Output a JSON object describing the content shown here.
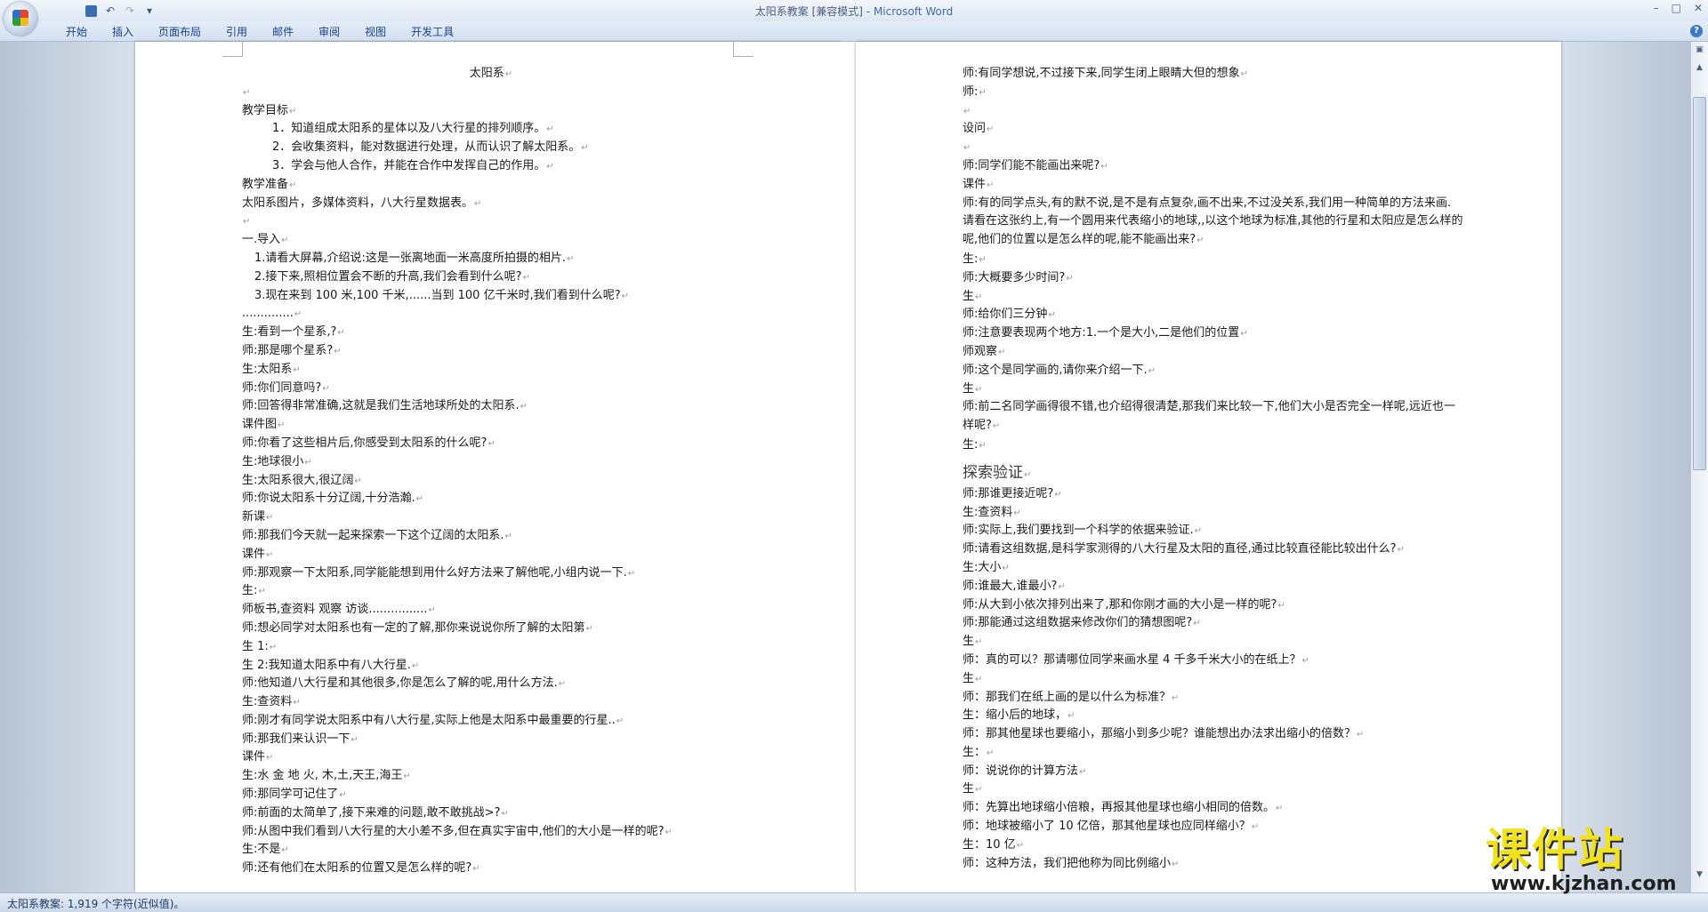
{
  "window": {
    "title_doc": "太阳系教案 [兼容模式]",
    "title_sep": " - ",
    "title_app": "Microsoft Word",
    "controls": {
      "minimize": "–",
      "maximize": "□",
      "close": "✕"
    }
  },
  "quick_access": {
    "undo": "↶",
    "redo": "↷",
    "more": "▾"
  },
  "ribbon_tabs": [
    "开始",
    "插入",
    "页面布局",
    "引用",
    "邮件",
    "审阅",
    "视图",
    "开发工具"
  ],
  "help": "?",
  "page1_lines": [
    "太阳系",
    "",
    "教学目标",
    "1．知道组成太阳系的星体以及八大行星的排列顺序。",
    "2．会收集资料，能对数据进行处理，从而认识了解太阳系。",
    "3．学会与他人合作，并能在合作中发挥自己的作用。",
    "教学准备",
    "太阳系图片，多媒体资料，八大行星数据表。",
    "",
    "一.导入",
    "1.请看大屏幕,介绍说:这是一张离地面一米高度所拍摄的相片.",
    "2.接下来,照相位置会不断的升高,我们会看到什么呢?",
    "3.现在来到 100 米,100 千米,......当到 100 亿千米时,我们看到什么呢?",
    "..............",
    "生:看到一个星系,?",
    "师:那是哪个星系?",
    "生:太阳系",
    "师:你们同意吗?",
    "师:回答得非常准确,这就是我们生活地球所处的太阳系.",
    "课件图",
    "师:你看了这些相片后,你感受到太阳系的什么呢?",
    "生:地球很小",
    "生:太阳系很大,很辽阔",
    "师:你说太阳系十分辽阔,十分浩瀚.",
    "新课",
    "师:那我们今天就一起来探索一下这个辽阔的太阳系.",
    "课件",
    "师:那观察一下太阳系,同学能能想到用什么好方法来了解他呢,小组内说一下.",
    "生:",
    "师板书,查资料  观察  访谈................",
    "师:想必同学对太阳系也有一定的了解,那你来说说你所了解的太阳第",
    "生 1:",
    "生 2:我知道太阳系中有八大行星.",
    "师:他知道八大行星和其他很多,你是怎么了解的呢,用什么方法.",
    "生:查资料",
    "师:刚才有同学说太阳系中有八大行星,实际上他是太阳系中最重要的行星..",
    "师:那我们来认识一下",
    "课件",
    "生:水  金  地  火,  木,土,天王,海王",
    "师:那同学可记住了",
    "师:前面的太简单了,接下来难的问题,敢不敢挑战>?",
    "师:从图中我们看到八大行星的大小差不多,但在真实宇宙中,他们的大小是一样的呢?",
    "生:不是",
    "师:还有他们在太阳系的位置又是怎么样的呢?"
  ],
  "page2_lines": [
    "师:有同学想说,不过接下来,同学生闭上眼睛大但的想象",
    "师:",
    "",
    "设问",
    "",
    "师:同学们能不能画出来呢?",
    "课件",
    "师:有的同学点头,有的默不说,是不是有点复杂,画不出来,不过没关系,我们用一种简单的方法来画.    请看在这张约上,有一个圆用来代表缩小的地球,,以这个地球为标准,其他的行星和太阳应是怎么样的呢,他们的位置以是怎么样的呢,能不能画出来?",
    "生:",
    "师:大概要多少时间?",
    "生",
    "师:给你们三分钟",
    "师:注意要表现两个地方:1.一个是大小,二是他们的位置",
    "师观察",
    "师:这个是同学画的,请你来介绍一下.",
    "生",
    "师:前二名同学画得很不错,也介绍得很清楚,那我们来比较一下,他们大小是否完全一样呢,远近也一样呢?",
    "生:",
    "探索验证",
    "师:那谁更接近呢?",
    "生:查资料",
    "师:实际上,我们要找到一个科学的依据来验证.",
    "师:请看这组数据,是科学家测得的八大行星及太阳的直径,通过比较直径能比较出什么?",
    "生:大小",
    "师:谁最大,谁最小?",
    "师:从大到小依次排列出来了,那和你刚才画的大小是一样的呢?",
    "师:那能通过这组数据来修改你们的猜想图呢?",
    "生",
    "师：真的可以？那请哪位同学来画水星 4 千多千米大小的在纸上？",
    "生",
    "师：那我们在纸上画的是以什么为标准？",
    "生：缩小后的地球，",
    "师：那其他星球也要缩小，那缩小到多少呢？谁能想出办法求出缩小的倍数？",
    "生：",
    "师：说说你的计算方法",
    "生",
    "师：先算出地球缩小倍粮，再报其他星球也缩小相同的倍数。",
    "师：地球被缩小了 10 亿倍，那其他星球也应同样缩小？",
    "生：10 亿",
    "师：这种方法，我们把他称为同比例缩小"
  ],
  "status": {
    "text": "太阳系教案: 1,919 个字符(近似值)。"
  },
  "watermark": {
    "title": "课件站",
    "url": "www.kjzhan.com"
  },
  "colors": {
    "ribbon_text": "#15428b",
    "watermark_yellow": "#f2e21b",
    "title_app": "#3e6aa8"
  }
}
